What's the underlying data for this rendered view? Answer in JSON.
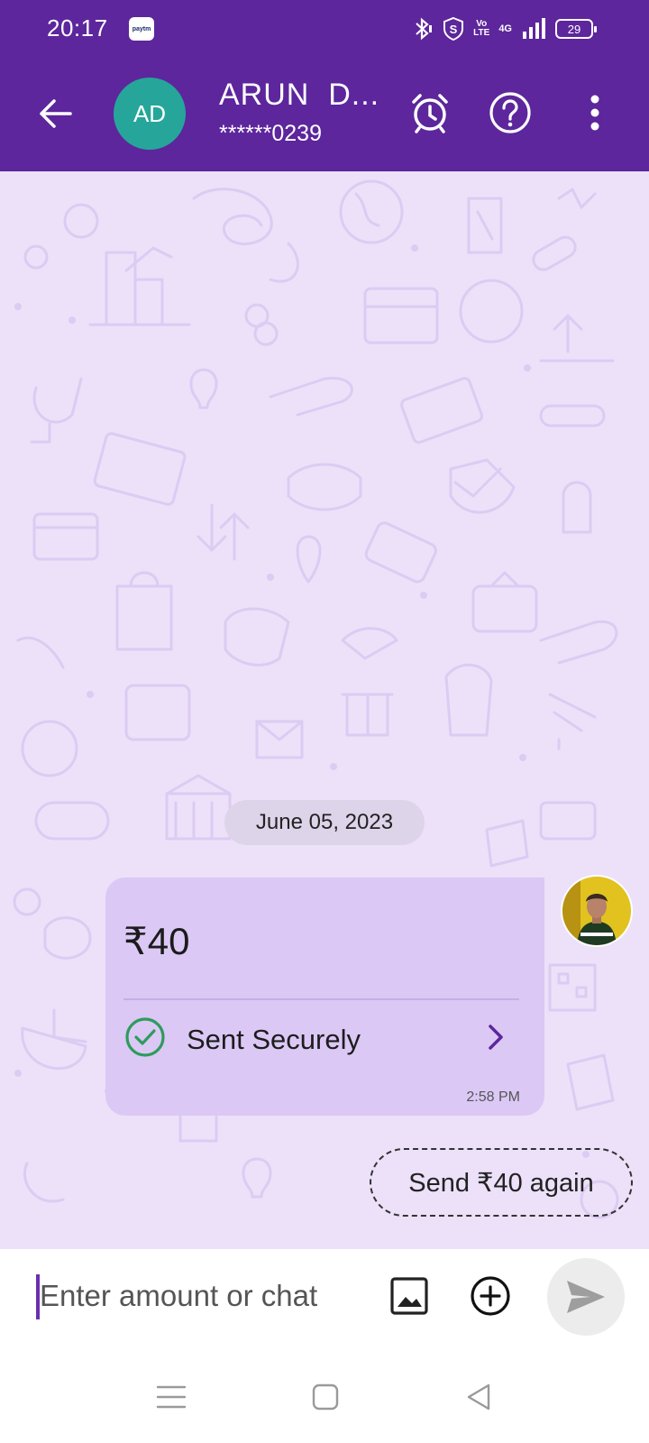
{
  "status_bar": {
    "time": "20:17",
    "paytm_badge": "paytm",
    "volte_top": "Vo",
    "volte_bottom": "LTE",
    "network": "4G",
    "battery": "29"
  },
  "header": {
    "avatar_initials": "AD",
    "contact_name": "ARUN  D...",
    "account_masked": "******0239",
    "icons": [
      "back-arrow-icon",
      "alarm-clock-icon",
      "help-icon",
      "more-vert-icon"
    ]
  },
  "chat": {
    "date_chip": "June 05, 2023",
    "message": {
      "amount": "₹40",
      "status": "Sent Securely",
      "time": "2:58 PM"
    },
    "send_again_label": "Send ₹40 again"
  },
  "input": {
    "placeholder": "Enter amount or chat",
    "value": ""
  },
  "colors": {
    "brand_purple": "#5d269c",
    "chat_background": "#ece1f9",
    "bubble": "#dbc8f5",
    "success_green": "#2e9b5d",
    "avatar_teal": "#26a69a"
  }
}
